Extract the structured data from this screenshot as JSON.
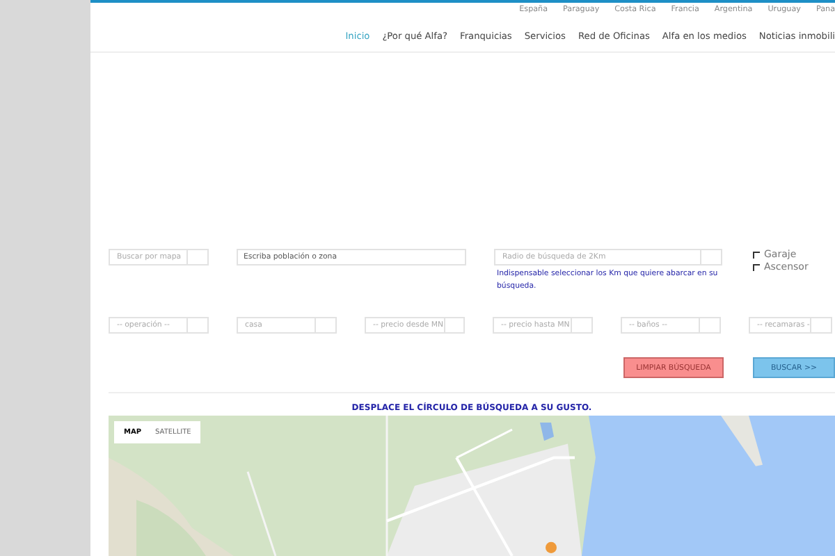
{
  "countries": [
    "España",
    "Paraguay",
    "Costa Rica",
    "Francia",
    "Argentina",
    "Uruguay",
    "Pana"
  ],
  "nav": [
    {
      "label": "Inicio",
      "selected": true
    },
    {
      "label": "¿Por qué Alfa?",
      "selected": false
    },
    {
      "label": "Franquicias",
      "selected": false
    },
    {
      "label": "Servicios",
      "selected": false
    },
    {
      "label": "Red de Oficinas",
      "selected": false
    },
    {
      "label": "Alfa en los medios",
      "selected": false
    },
    {
      "label": "Noticias inmobili",
      "selected": false
    }
  ],
  "search_row_1": [
    {
      "kind": "select",
      "value": "Buscar por mapa"
    },
    {
      "kind": "input",
      "value": "Escriba población o zona"
    },
    {
      "kind": "select",
      "value": "Radio de búsqueda de 2Km",
      "hint": "Indispensable seleccionar los Km que quiere abarcar en su búsqueda."
    }
  ],
  "checkboxes": [
    {
      "label": "Garaje",
      "checked": false
    },
    {
      "label": "Ascensor",
      "checked": false
    }
  ],
  "search_row_2": [
    {
      "value": "-- operación --"
    },
    {
      "value": "casa"
    },
    {
      "value": "-- precio desde MN"
    },
    {
      "value": "-- precio hasta MN"
    },
    {
      "value": "-- baños --"
    },
    {
      "value": "-- recamaras -"
    }
  ],
  "buttons": [
    {
      "label": "LIMPIAR BÚSQUEDA",
      "kind": "clear"
    },
    {
      "label": "BUSCAR >>",
      "kind": "search"
    }
  ],
  "map": {
    "title": "DESPLACE EL CÍRCULO DE BÚSQUEDA A SU GUSTO.",
    "types": [
      {
        "label": "MAP",
        "selected": true
      },
      {
        "label": "SATELLITE",
        "selected": false
      }
    ]
  }
}
